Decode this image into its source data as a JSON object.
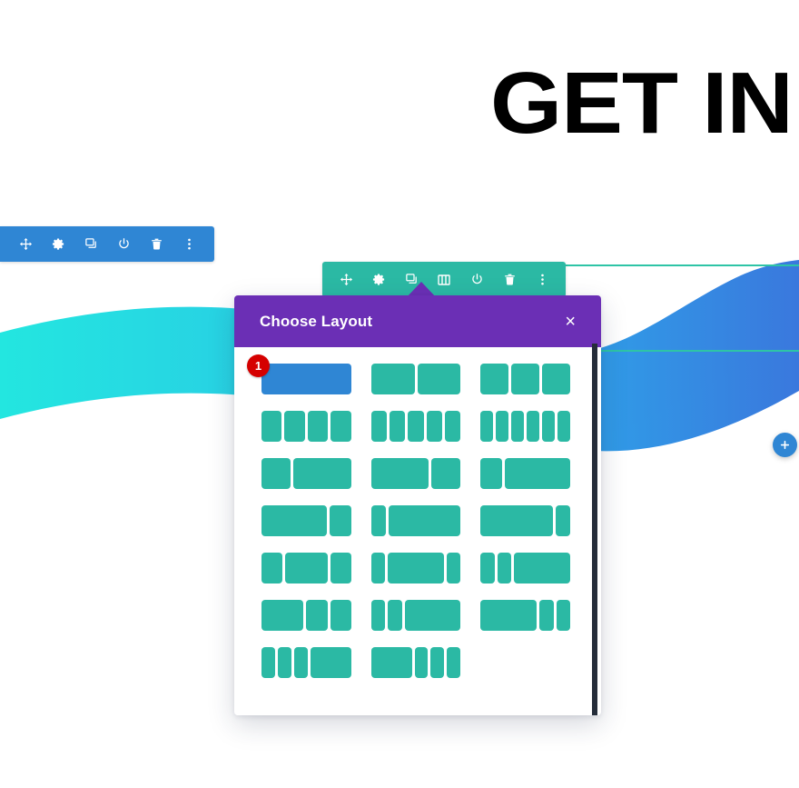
{
  "page": {
    "headline": "GET IN",
    "background": {
      "wave_left_color_start": "#23e6e0",
      "wave_left_color_end": "#2fb4e8",
      "wave_right_color_start": "#2f9fe8",
      "wave_right_color_end": "#3a78dd"
    },
    "guide_line_color": "#2ec4a6"
  },
  "row_toolbar": {
    "name": "row-settings-toolbar",
    "background_color": "#2f86d4",
    "icons": [
      {
        "name": "move-icon",
        "label": "Move Row"
      },
      {
        "name": "gear-icon",
        "label": "Row Settings"
      },
      {
        "name": "duplicate-icon",
        "label": "Duplicate Row"
      },
      {
        "name": "power-icon",
        "label": "Disable Row"
      },
      {
        "name": "trash-icon",
        "label": "Delete Row"
      },
      {
        "name": "kebab-menu-icon",
        "label": "More Options"
      }
    ]
  },
  "section_toolbar": {
    "name": "section-settings-toolbar",
    "background_color": "#2bb9a4",
    "icons": [
      {
        "name": "move-icon",
        "label": "Move Section",
        "active": false
      },
      {
        "name": "gear-icon",
        "label": "Section Settings",
        "active": false
      },
      {
        "name": "duplicate-icon",
        "label": "Duplicate Section",
        "active": false
      },
      {
        "name": "columns-icon",
        "label": "Choose Column Layout",
        "active": true
      },
      {
        "name": "power-icon",
        "label": "Disable Section",
        "active": false
      },
      {
        "name": "trash-icon",
        "label": "Delete Section",
        "active": false
      },
      {
        "name": "kebab-menu-icon",
        "label": "More Options",
        "active": false
      }
    ]
  },
  "modal": {
    "title": "Choose Layout",
    "close_label": "×",
    "header_color": "#6b2fb5",
    "badge": "1",
    "layouts": [
      {
        "name": "layout-1-column",
        "widths": [
          12
        ],
        "selected": true
      },
      {
        "name": "layout-2-column",
        "widths": [
          6,
          6
        ],
        "selected": false
      },
      {
        "name": "layout-3-column",
        "widths": [
          4,
          4,
          4
        ],
        "selected": false
      },
      {
        "name": "layout-4-column",
        "widths": [
          3,
          3,
          3,
          3
        ],
        "selected": false
      },
      {
        "name": "layout-5-column",
        "widths": [
          2.4,
          2.4,
          2.4,
          2.4,
          2.4
        ],
        "selected": false
      },
      {
        "name": "layout-6-column",
        "widths": [
          2,
          2,
          2,
          2,
          2,
          2
        ],
        "selected": false
      },
      {
        "name": "layout-third-twothirds",
        "widths": [
          4,
          8
        ],
        "selected": false
      },
      {
        "name": "layout-twothirds-third",
        "widths": [
          8,
          4
        ],
        "selected": false
      },
      {
        "name": "layout-quarter-threequarter",
        "widths": [
          3,
          9
        ],
        "selected": false
      },
      {
        "name": "layout-threequarter-quarter",
        "widths": [
          9,
          3
        ],
        "selected": false
      },
      {
        "name": "layout-sixth-fivesixth",
        "widths": [
          2,
          10
        ],
        "selected": false
      },
      {
        "name": "layout-fivesixth-sixth",
        "widths": [
          10,
          2
        ],
        "selected": false
      },
      {
        "name": "layout-quarter-half-quarter",
        "widths": [
          3,
          6,
          3
        ],
        "selected": false
      },
      {
        "name": "layout-sixth-twothirds-sixth",
        "widths": [
          2,
          8,
          2
        ],
        "selected": false
      },
      {
        "name": "layout-sixth-sixth-twothirds",
        "widths": [
          2,
          2,
          8
        ],
        "selected": false
      },
      {
        "name": "layout-half-quarter-quarter",
        "widths": [
          6,
          3,
          3
        ],
        "selected": false
      },
      {
        "name": "layout-sixth-sixth-half",
        "widths": [
          2,
          2,
          8
        ],
        "selected": false
      },
      {
        "name": "layout-twothirds-sixth-sixth",
        "widths": [
          8,
          2,
          2
        ],
        "selected": false
      },
      {
        "name": "layout-sixth-x3-half",
        "widths": [
          2,
          2,
          2,
          6
        ],
        "selected": false
      },
      {
        "name": "layout-half-sixth-x3",
        "widths": [
          6,
          2,
          2,
          2
        ],
        "selected": false
      }
    ]
  },
  "add_button": {
    "name": "add-section-button",
    "icon": "plus-icon",
    "color": "#2f86d4"
  }
}
